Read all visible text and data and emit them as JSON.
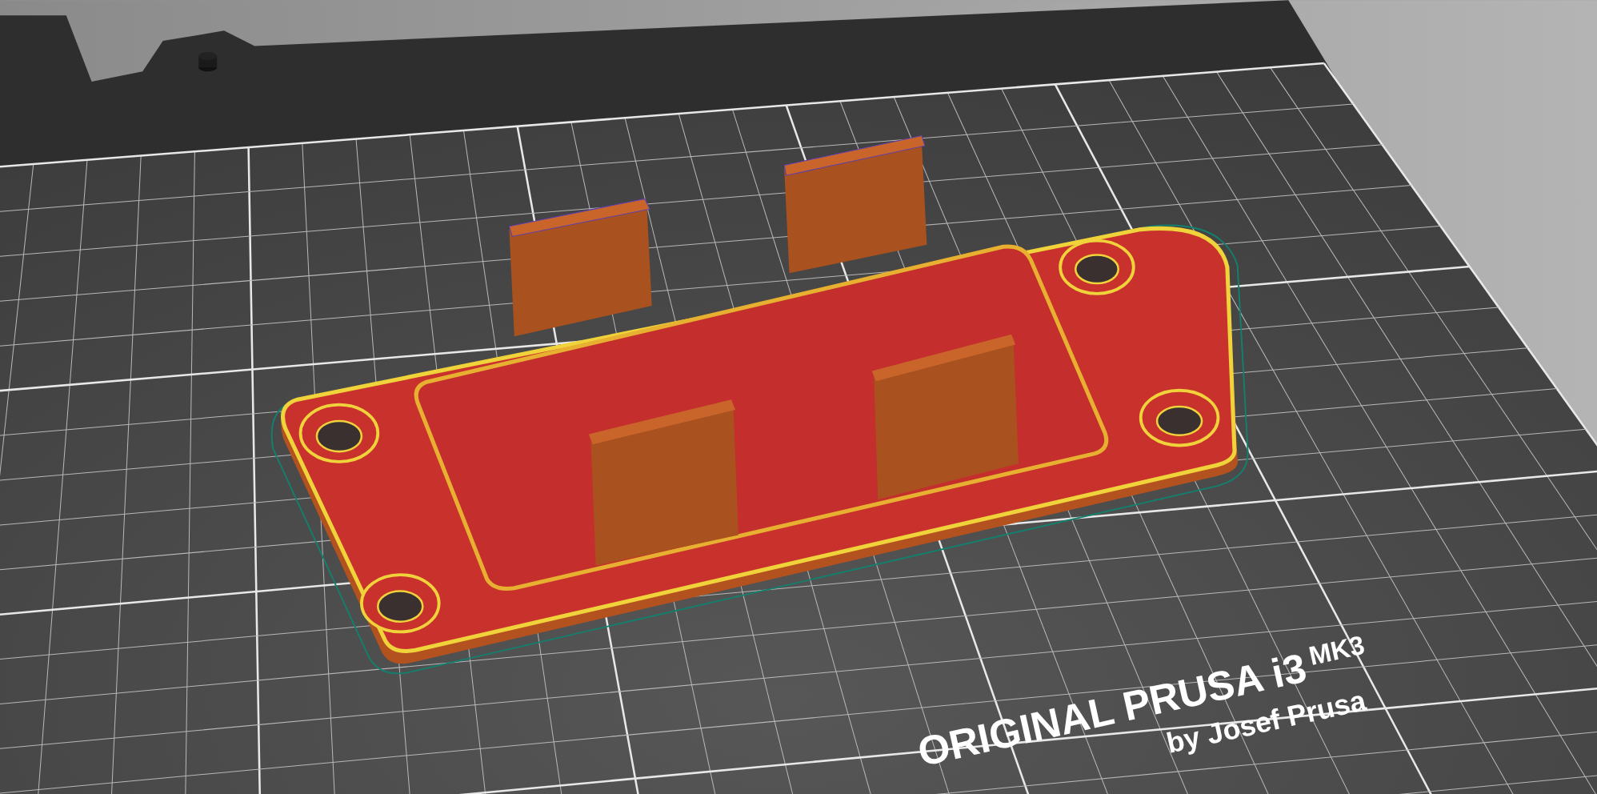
{
  "bed_label": {
    "title": "ORIGINAL PRUSA i3",
    "model": "MK3",
    "subtitle": "by Josef Prusa"
  }
}
